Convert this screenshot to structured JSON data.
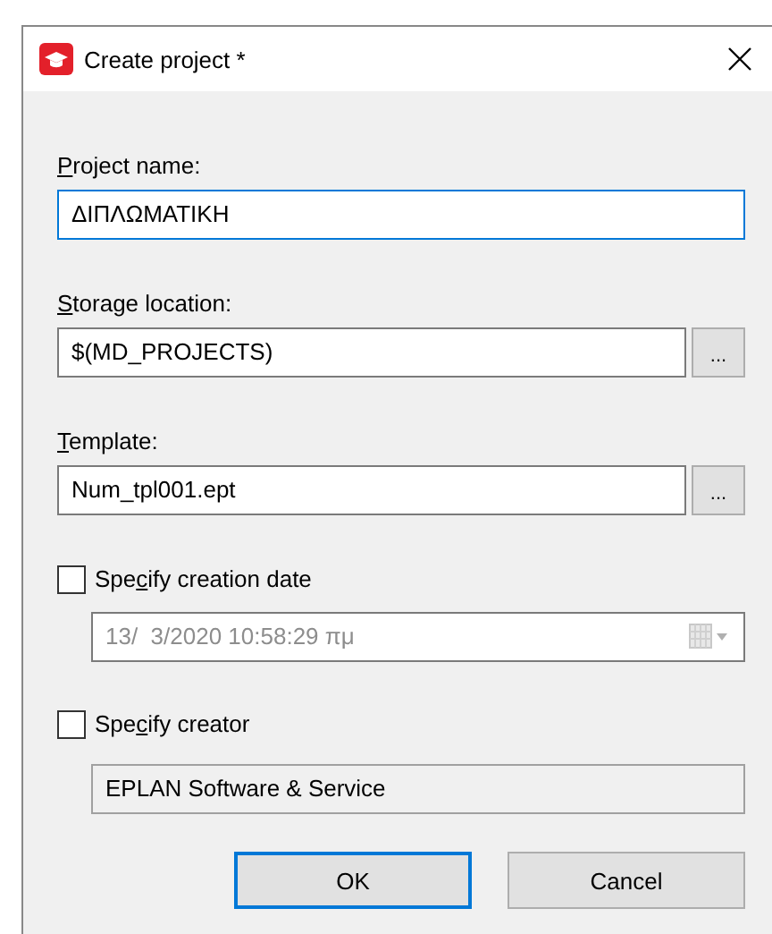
{
  "window": {
    "title": "Create project *"
  },
  "fields": [
    {
      "kind": "text",
      "label": {
        "key": "P",
        "post": "roject name:"
      },
      "value": "ΔΙΠΛΩΜΑΤΙΚΗ",
      "focused": true
    },
    {
      "kind": "text",
      "label": {
        "key": "S",
        "post": "torage location:"
      },
      "value": "$(MD_PROJECTS)",
      "focused": false,
      "browse": "..."
    },
    {
      "kind": "text",
      "label": {
        "key": "T",
        "post": "emplate:"
      },
      "value": "Num_tpl001.ept",
      "focused": false,
      "browse": "..."
    },
    {
      "kind": "check",
      "label": {
        "pre": "Spe",
        "key": "c",
        "post": "ify creation date"
      },
      "checked": false,
      "value": "13/  3/2020 10:58:29 πμ",
      "disabled": true,
      "picker": true
    },
    {
      "kind": "check",
      "label": {
        "pre": "Spe",
        "key": "c",
        "post": "ify creator"
      },
      "checked": false,
      "value": "EPLAN Software & Service",
      "disabled": true,
      "picker": false
    }
  ],
  "buttons": [
    {
      "label": "OK",
      "default": true
    },
    {
      "label": "Cancel",
      "default": false
    }
  ]
}
